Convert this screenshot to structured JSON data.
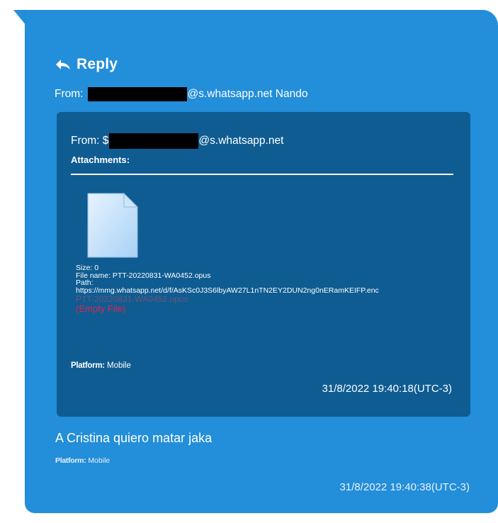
{
  "bubble_color": "#238ed9",
  "quoted_color": "#0f5c92",
  "reply": {
    "icon": "reply-arrow-icon",
    "label": "Reply"
  },
  "outer_from": {
    "label": "From:",
    "domain_suffix": "@s.whatsapp.net Nando"
  },
  "quoted_message": {
    "from_label": "From: $",
    "domain_suffix": "@s.whatsapp.net",
    "attachments_title": "Attachments:",
    "file_icon": "document-file-icon",
    "size": "Size: 0",
    "file_name": "File name: PTT-20220831-WA0452.opus",
    "path_label": "Path:",
    "path_value": "https://mmg.whatsapp.net/d/f/AsKSc0J3S6lbyAW27L1nTN2EY2DUN2ng0nERamKEIFP.enc",
    "ghost_file_name": "PTT-20220831-WA0452.opus",
    "empty_file": "(Empty File)",
    "platform_label": "Platform:",
    "platform_value": "Mobile",
    "timestamp": "31/8/2022 19:40:18(UTC-3)"
  },
  "message": {
    "text": "A Cristina quiero matar jaka",
    "platform_label": "Platform:",
    "platform_value": "Mobile",
    "timestamp": "31/8/2022 19:40:38(UTC-3)"
  }
}
